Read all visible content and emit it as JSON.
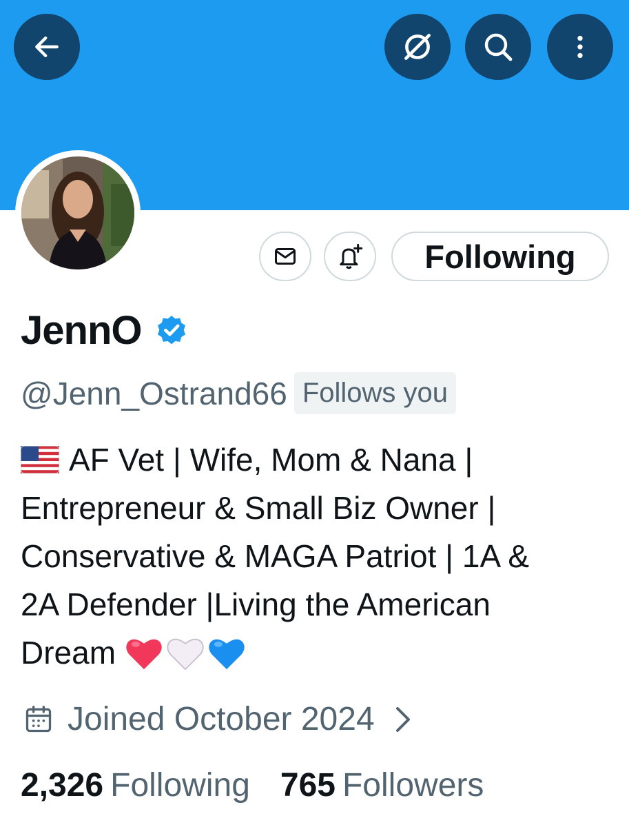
{
  "header": {
    "icons": [
      "back-arrow-icon",
      "grok-icon",
      "search-icon",
      "more-vertical-icon"
    ],
    "banner_color": "#1d9bf0",
    "button_color": "#12456e"
  },
  "profile": {
    "name": "JennO",
    "handle": "@Jenn_Ostrand66",
    "follows_you": "Follows you",
    "verified": true,
    "accent": "#1d9bf0"
  },
  "actions": {
    "message_icon": "mail-icon",
    "notify_icon": "bell-plus-icon",
    "follow_label": "Following"
  },
  "bio": {
    "line1": "AF Vet | Wife, Mom & Nana |",
    "line2": "Entrepreneur  & Small Biz Owner |",
    "line3": "Conservative & MAGA Patriot | 1A &",
    "line4": "2A Defender |Living the American",
    "line5": "Dream",
    "emoji_prefix": "us-flag",
    "emoji_suffix": [
      "red-heart",
      "white-heart",
      "blue-heart"
    ]
  },
  "joined": {
    "text": "Joined October 2024",
    "icon": "calendar-icon"
  },
  "stats": {
    "following_count": "2,326",
    "following_label": "Following",
    "followers_count": "765",
    "followers_label": "Followers"
  }
}
